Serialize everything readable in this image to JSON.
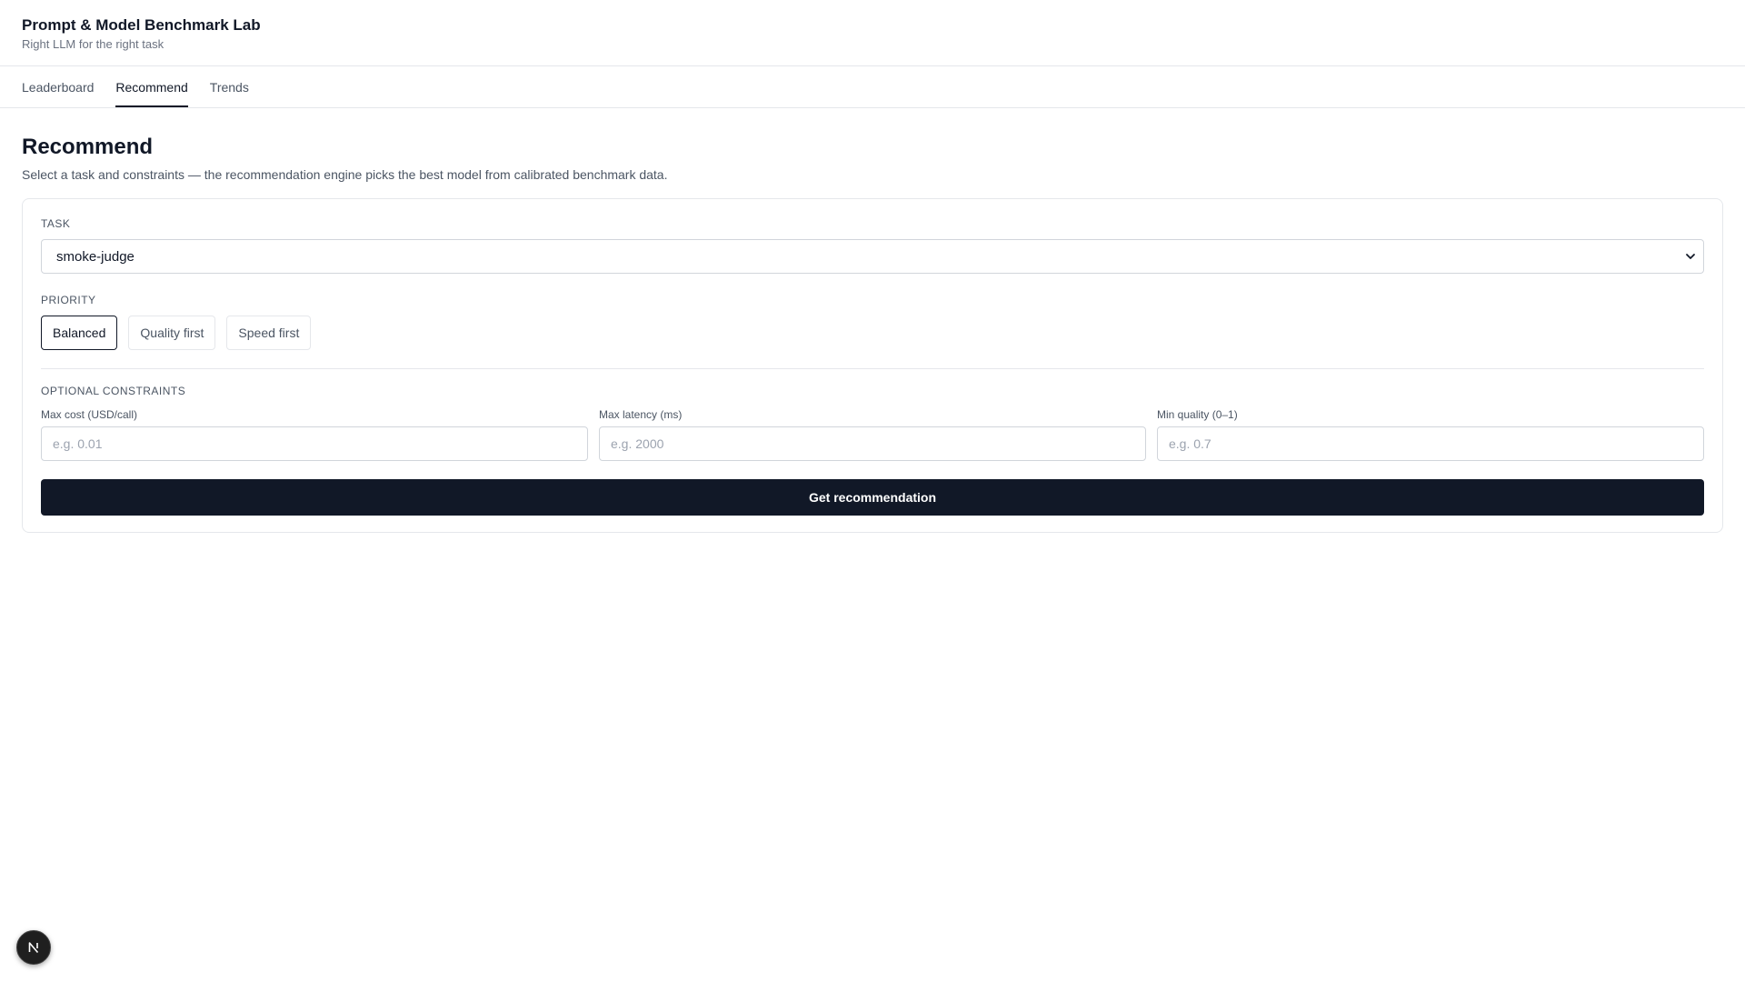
{
  "header": {
    "title": "Prompt & Model Benchmark Lab",
    "subtitle": "Right LLM for the right task"
  },
  "tabs": [
    {
      "label": "Leaderboard",
      "active": false
    },
    {
      "label": "Recommend",
      "active": true
    },
    {
      "label": "Trends",
      "active": false
    }
  ],
  "page": {
    "title": "Recommend",
    "description": "Select a task and constraints — the recommendation engine picks the best model from calibrated benchmark data."
  },
  "form": {
    "task_label": "TASK",
    "task_value": "smoke-judge",
    "priority_label": "PRIORITY",
    "priority_options": [
      {
        "label": "Balanced",
        "selected": true
      },
      {
        "label": "Quality first",
        "selected": false
      },
      {
        "label": "Speed first",
        "selected": false
      }
    ],
    "constraints_label": "OPTIONAL CONSTRAINTS",
    "fields": [
      {
        "label": "Max cost (USD/call)",
        "placeholder": "e.g. 0.01",
        "value": ""
      },
      {
        "label": "Max latency (ms)",
        "placeholder": "e.g. 2000",
        "value": ""
      },
      {
        "label": "Min quality (0–1)",
        "placeholder": "e.g. 0.7",
        "value": ""
      }
    ],
    "submit_label": "Get recommendation"
  },
  "colors": {
    "primary": "#111827",
    "border": "#e5e7eb",
    "muted_text": "#4b5563"
  },
  "icons": {
    "select_chevron": "chevron-down-icon",
    "dev_badge": "nextjs-logo-icon"
  }
}
